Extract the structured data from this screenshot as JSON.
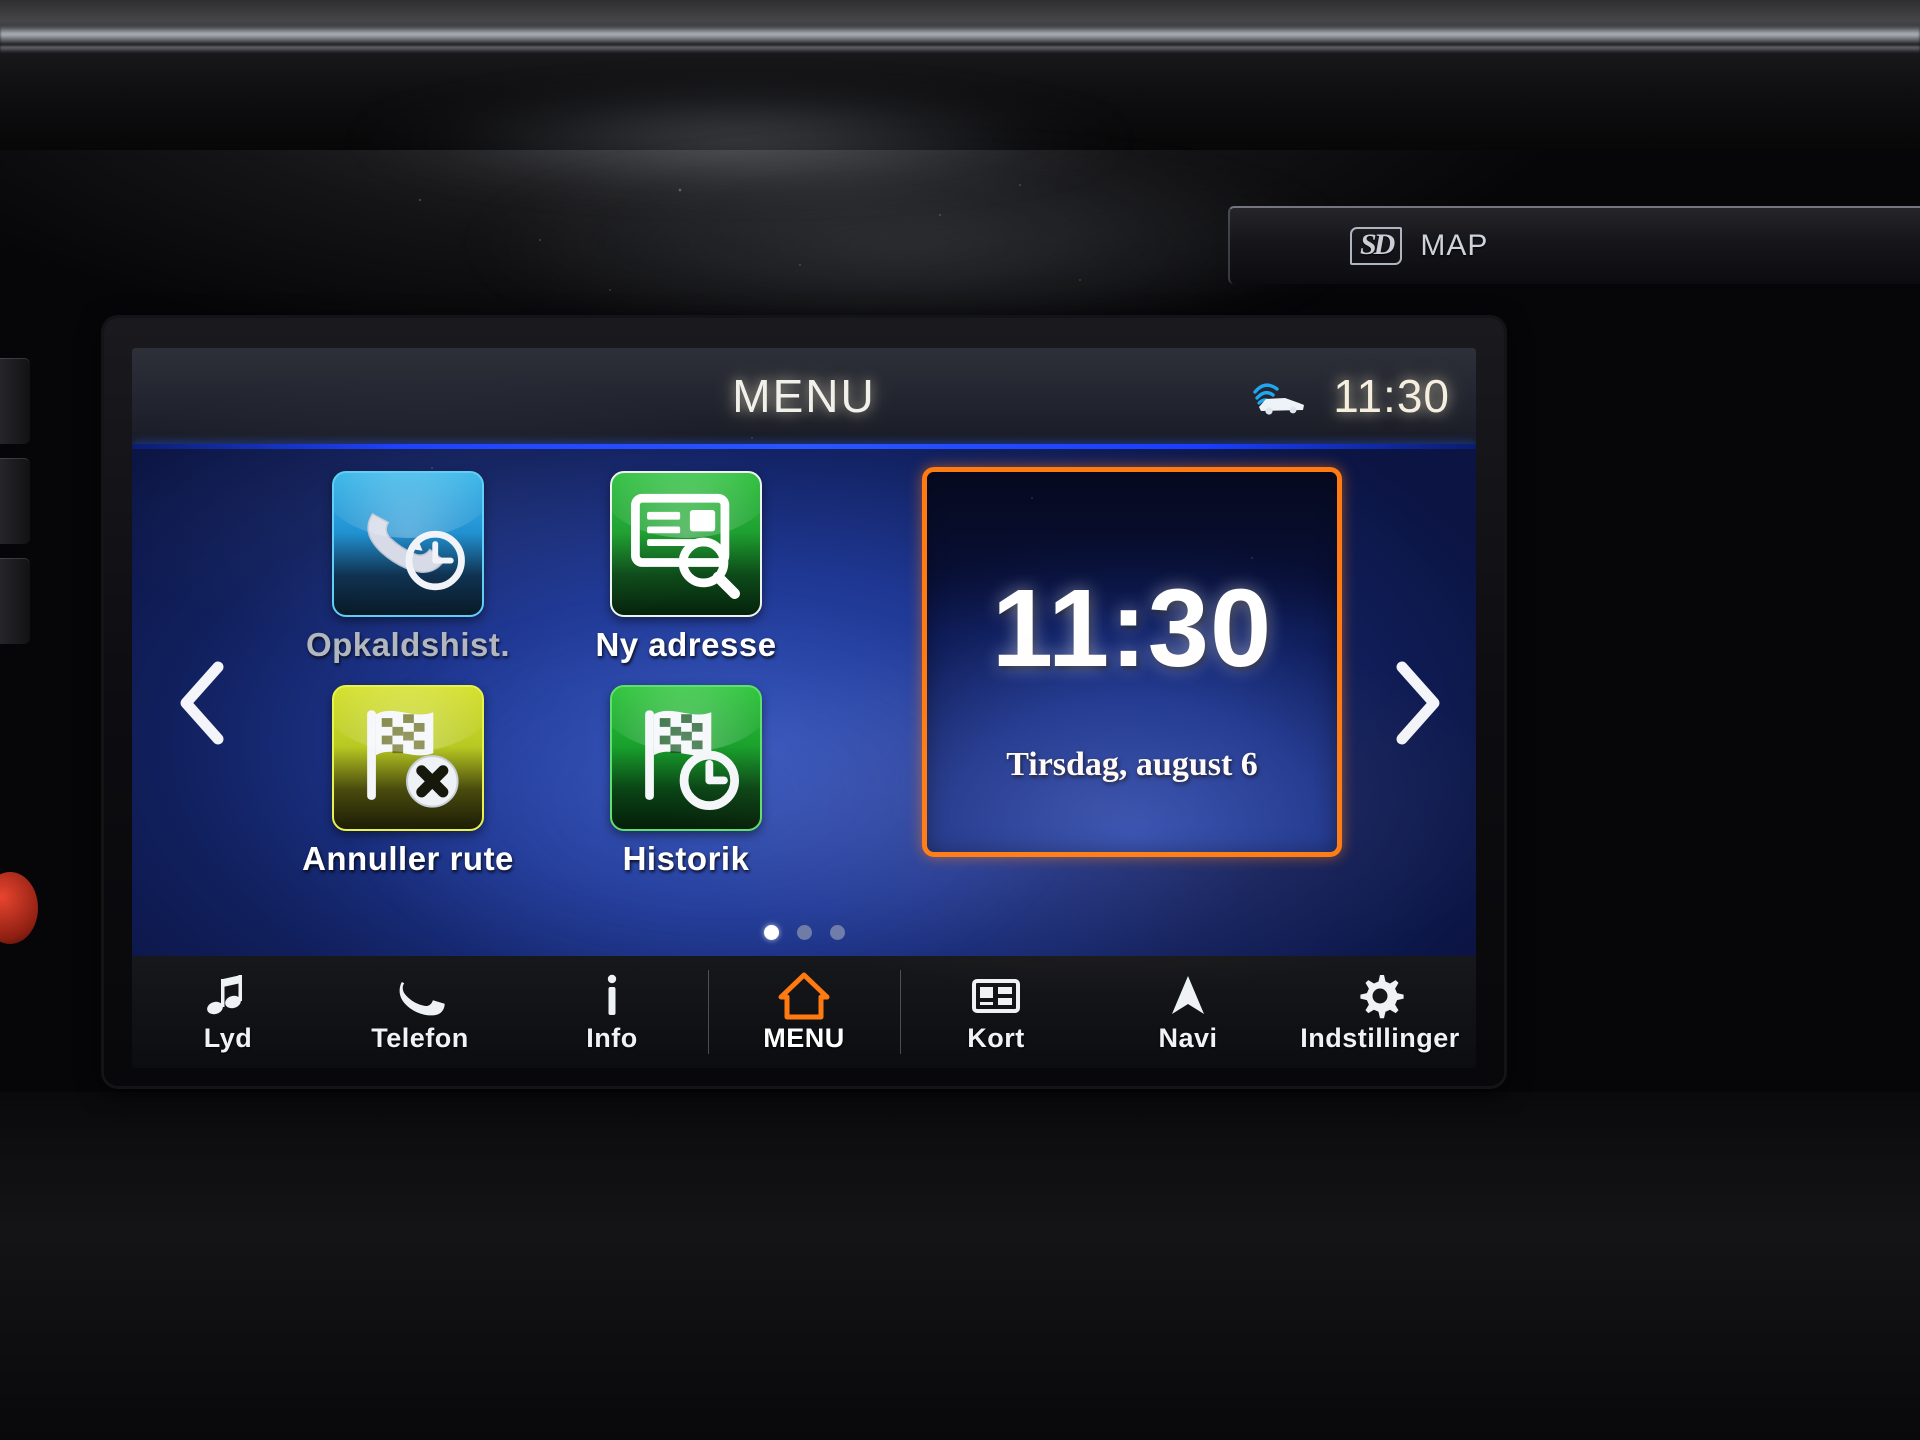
{
  "device": {
    "sd_logo_text": "SD",
    "sd_map_label": "MAP"
  },
  "header": {
    "title": "MENU",
    "clock": "11:30",
    "traffic_icon": "traffic-car-signal-icon"
  },
  "tiles": [
    {
      "label": "Opkaldshist.",
      "icon": "phone-handset-clock-icon",
      "color": "#1a8fd0",
      "dimmed": true
    },
    {
      "label": "Ny adresse",
      "icon": "address-card-search-icon",
      "color": "#1da02f",
      "dimmed": false
    },
    {
      "label": "Annuller rute",
      "icon": "checkered-flag-cancel-icon",
      "color": "#b8c922",
      "dimmed": false
    },
    {
      "label": "Historik",
      "icon": "checkered-flag-clock-icon",
      "color": "#18a02c",
      "dimmed": false
    }
  ],
  "clock_widget": {
    "time": "11:30",
    "date": "Tirsdag, august 6",
    "border_color": "#ff7a10"
  },
  "pagination": {
    "total": 3,
    "active_index": 0
  },
  "nav_arrows": {
    "prev_icon": "chevron-left-icon",
    "next_icon": "chevron-right-icon"
  },
  "bottom_nav": [
    {
      "label": "Lyd",
      "icon": "music-note-icon",
      "active": false
    },
    {
      "label": "Telefon",
      "icon": "phone-icon",
      "active": false
    },
    {
      "label": "Info",
      "icon": "info-icon",
      "active": false
    },
    {
      "label": "MENU",
      "icon": "home-icon",
      "active": true
    },
    {
      "label": "Kort",
      "icon": "map-icon",
      "active": false
    },
    {
      "label": "Navi",
      "icon": "navigation-arrow-icon",
      "active": false
    },
    {
      "label": "Indstillinger",
      "icon": "gear-icon",
      "active": false
    }
  ],
  "colors": {
    "accent_orange": "#ff7a10",
    "header_rule_blue": "#2a55ff",
    "screen_blue": "#1f3894"
  }
}
